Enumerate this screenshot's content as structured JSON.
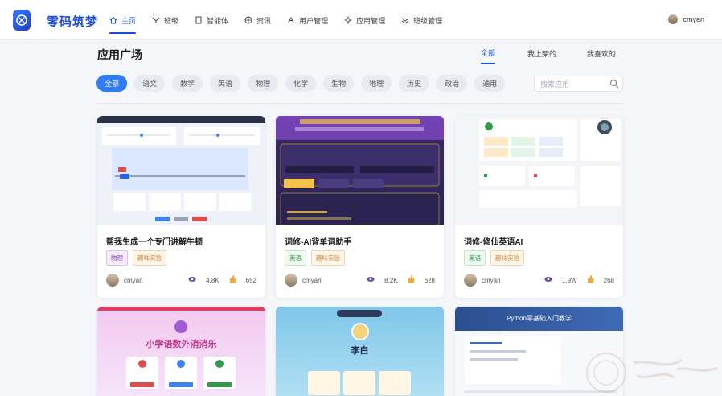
{
  "app": {
    "brand": "零码筑梦"
  },
  "nav": [
    {
      "label": "主页",
      "icon": "home-icon"
    },
    {
      "label": "班级",
      "icon": "class-icon"
    },
    {
      "label": "智能体",
      "icon": "doc-icon"
    },
    {
      "label": "资讯",
      "icon": "globe-icon"
    },
    {
      "label": "用户管理",
      "icon": "user-icon"
    },
    {
      "label": "应用管理",
      "icon": "gear-icon"
    },
    {
      "label": "班级管理",
      "icon": "manage-icon"
    }
  ],
  "user": {
    "name": "cmyan"
  },
  "page": {
    "title": "应用广场"
  },
  "scope_tabs": [
    "全部",
    "我上架的",
    "我喜欢的"
  ],
  "filters": [
    "全部",
    "语文",
    "数学",
    "英语",
    "物理",
    "化学",
    "生物",
    "地理",
    "历史",
    "政治",
    "通用"
  ],
  "search": {
    "placeholder": "搜索应用"
  },
  "cards": [
    {
      "title": "帮我生成一个专门讲解牛顿",
      "tags": [
        "物理",
        "趣味实验"
      ],
      "author": "cmyan",
      "views": "4.8K",
      "likes": "652"
    },
    {
      "title": "词修-AI背单词助手",
      "tags": [
        "英语",
        "趣味实验"
      ],
      "author": "cmyan",
      "views": "8.2K",
      "likes": "628"
    },
    {
      "title": "词修-修仙英语AI",
      "tags": [
        "英语",
        "趣味实验"
      ],
      "author": "cmyan",
      "views": "1.9W",
      "likes": "268"
    }
  ],
  "row2": {
    "card1_title": "小学语数外消消乐",
    "card2_title": "李白",
    "card3_title": "Python零基础入门教学"
  },
  "colors": {
    "accent": "#1d4ed8",
    "chip_active": "#2f7cf6"
  }
}
